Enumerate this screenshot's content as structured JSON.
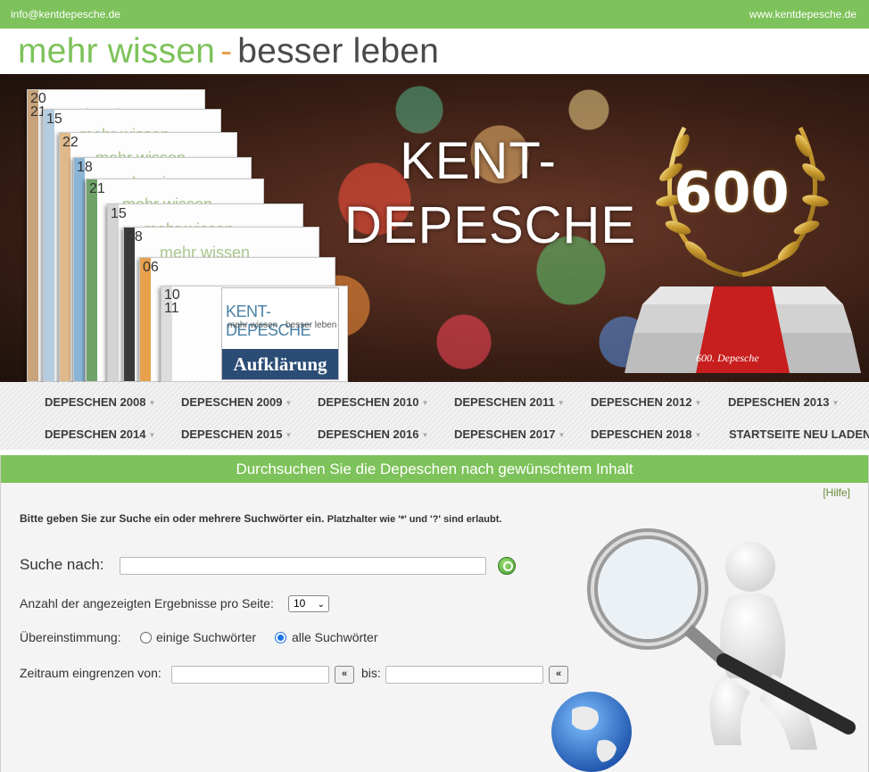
{
  "topbar": {
    "email": "info@kentdepesche.de",
    "site": "www.kentdepesche.de"
  },
  "tagline": {
    "part1": "mehr wissen",
    "dash": "-",
    "part2": "besser leben"
  },
  "banner": {
    "title_line1": "KENT-",
    "title_line2": "DEPESCHE",
    "badge": "600",
    "podium_label": "600. Depesche",
    "papers": [
      "20\n21",
      "15",
      "22",
      "18",
      "21",
      "15",
      "08",
      "06",
      "10\n11"
    ],
    "paper_text": "mehr wissen",
    "front_title": "KENT-DEPESCHE",
    "front_sub": "mehr wissen - besser leben",
    "front_banner": "Aufklärung"
  },
  "nav": {
    "row1": [
      "DEPESCHEN 2008",
      "DEPESCHEN 2009",
      "DEPESCHEN 2010",
      "DEPESCHEN 2011",
      "DEPESCHEN 2012",
      "DEPESCHEN 2013"
    ],
    "row2": [
      "DEPESCHEN 2014",
      "DEPESCHEN 2015",
      "DEPESCHEN 2016",
      "DEPESCHEN 2017",
      "DEPESCHEN 2018",
      "STARTSEITE NEU LADEN"
    ]
  },
  "search": {
    "heading": "Durchsuchen Sie die Depeschen nach gewünschtem Inhalt",
    "help": "[Hilfe]",
    "instruction_main": "Bitte geben Sie zur Suche ein oder mehrere Suchwörter ein.",
    "instruction_small": "Platzhalter wie '*' und '?' sind erlaubt.",
    "search_label": "Suche nach:",
    "search_value": "",
    "results_label": "Anzahl der angezeigten Ergebnisse pro Seite:",
    "results_value": "10",
    "match_label": "Übereinstimmung:",
    "match_option_any": "einige Suchwörter",
    "match_option_all": "alle Suchwörter",
    "match_selected": "all",
    "range_label": "Zeitraum eingrenzen von:",
    "range_from": "",
    "range_btn": "«",
    "range_to_label": "bis:",
    "range_to": ""
  },
  "colors": {
    "brand_green": "#7dc25a",
    "accent_orange": "#e8a04d",
    "text_dark": "#3b3b3b",
    "radio_blue": "#1a73e8"
  }
}
